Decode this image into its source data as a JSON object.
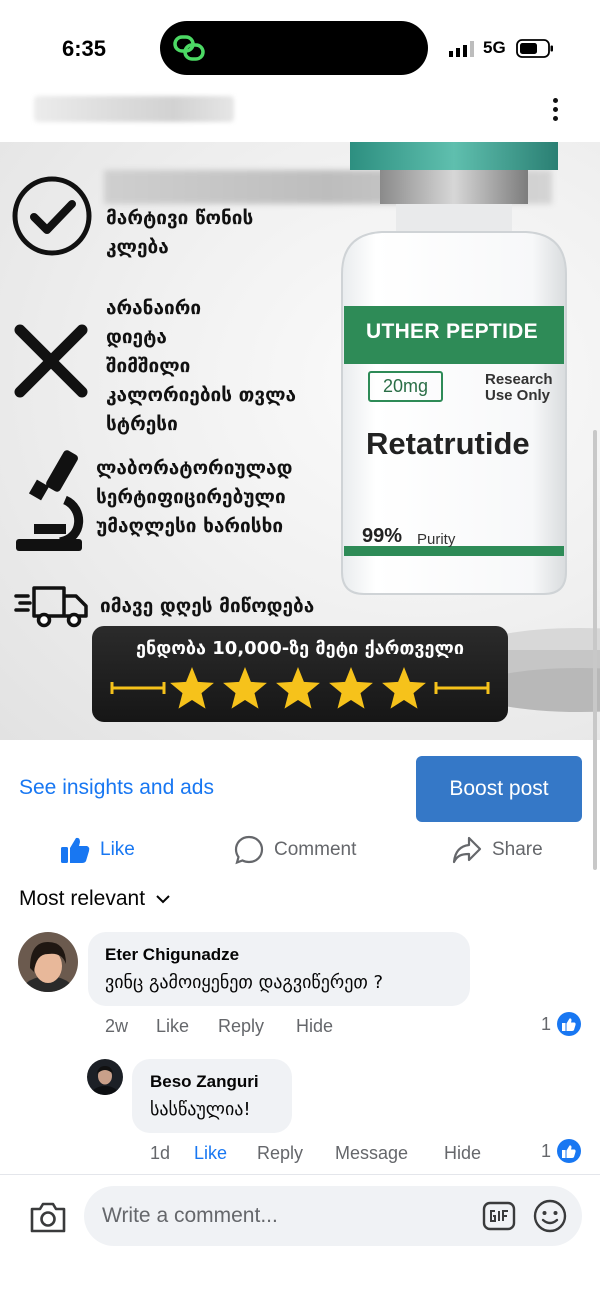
{
  "status_bar": {
    "time": "6:35",
    "network": "5G"
  },
  "ad": {
    "features": [
      {
        "icon": "checkmark-icon",
        "text": "მარტივი წონის\nკლება"
      },
      {
        "icon": "cross-icon",
        "text": "არანაირი\nდიეტა\nშიმშილი\nკალორიების თვლა\nსტრესი"
      },
      {
        "icon": "microscope-icon",
        "text": "ლაბორატორიულად\nსერტიფიცირებული\nუმაღლესი ხარისხი"
      },
      {
        "icon": "delivery-truck-icon",
        "text": "იმავე დღეს მიწოდება"
      }
    ],
    "vial": {
      "brand": "UTHER PEPTIDE",
      "dose": "20mg",
      "research": "Research\nUse Only",
      "product": "Retatrutide",
      "purity_value": "99%",
      "purity_label": "Purity"
    },
    "rating": {
      "text": "ენდობა 10,000-ზე მეტი ქართველი",
      "stars": 5
    }
  },
  "post_actions": {
    "insights": "See insights and ads",
    "boost": "Boost post"
  },
  "reactions": {
    "like": "Like",
    "comment": "Comment",
    "share": "Share"
  },
  "comments_sort": "Most relevant",
  "comments": [
    {
      "author": "Eter Chigunadze",
      "text": "ვინც გამოიყენეთ დაგვიწერეთ ?",
      "time": "2w",
      "like": "Like",
      "reply": "Reply",
      "hide": "Hide",
      "likes": "1"
    },
    {
      "author": "Beso Zanguri",
      "text": "სასწაულია!",
      "time": "1d",
      "like": "Like",
      "reply": "Reply",
      "message": "Message",
      "hide": "Hide",
      "likes": "1"
    }
  ],
  "composer": {
    "placeholder": "Write a comment..."
  },
  "colors": {
    "accent": "#1877f2",
    "boost": "#3578c7",
    "vial_green": "#2e8b57",
    "star": "#f6c21b"
  }
}
